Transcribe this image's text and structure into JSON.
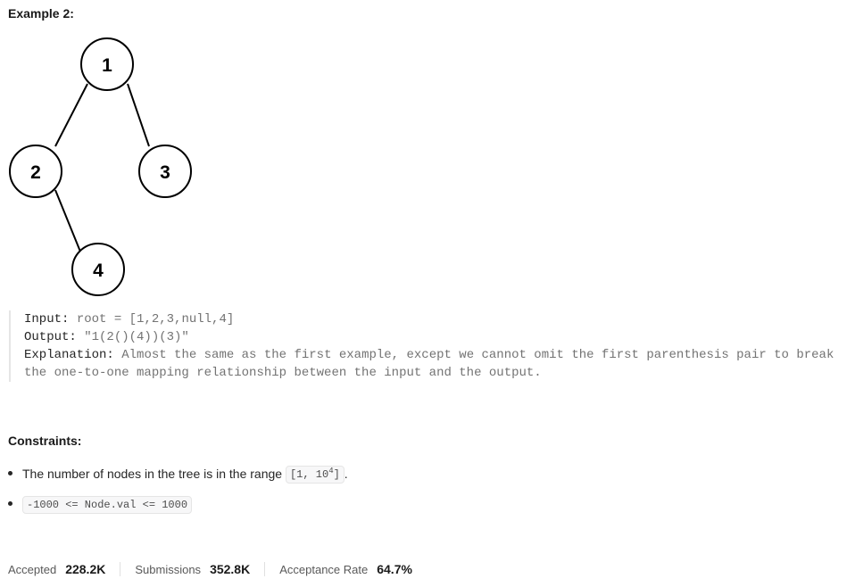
{
  "example": {
    "title": "Example 2:",
    "tree_nodes": [
      "1",
      "2",
      "3",
      "4"
    ],
    "input_label": "Input:",
    "input_value": "root = [1,2,3,null,4]",
    "output_label": "Output:",
    "output_value": "\"1(2()(4))(3)\"",
    "explanation_label": "Explanation:",
    "explanation_value": "Almost the same as the first example, except we cannot omit the first parenthesis pair to break the one-to-one mapping relationship between the input and the output."
  },
  "constraints": {
    "title": "Constraints:",
    "item1_text": "The number of nodes in the tree is in the range",
    "item1_code_prefix": "[1, 10",
    "item1_code_sup": "4",
    "item1_code_suffix": "]",
    "item1_end": ".",
    "item2_code": "-1000 <= Node.val <= 1000"
  },
  "stats": {
    "accepted_label": "Accepted",
    "accepted_value": "228.2K",
    "submissions_label": "Submissions",
    "submissions_value": "352.8K",
    "acceptance_rate_label": "Acceptance Rate",
    "acceptance_rate_value": "64.7%"
  }
}
